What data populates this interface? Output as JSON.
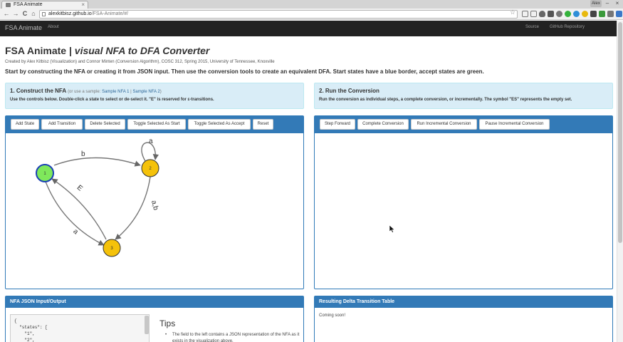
{
  "browser": {
    "tab_title": "FSA Animate",
    "tab_close": "×",
    "url_host": "alexkitbisz.github.io",
    "url_path": "/FSA-Animate/#/",
    "back": "←",
    "forward": "→",
    "reload": "C",
    "home": "⌂",
    "star": "☆",
    "user_badge": "Alex",
    "minimize": "–",
    "close": "×"
  },
  "navbar": {
    "brand": "FSA Animate",
    "about": "About",
    "source": "Source",
    "github": "GitHub Repository"
  },
  "header": {
    "title_plain": "FSA Animate | ",
    "title_italic": "visual NFA to DFA Converter",
    "credits": "Created by Alex Kitbisz (Visualization) and Connor Minten (Conversion Algorithm), COSC 312, Spring 2015, University of Tennessee, Knoxville",
    "instructions": "Start by constructing the NFA or creating it from JSON input. Then use the conversion tools to create an equivalent DFA. Start states have a blue border, accept states are green."
  },
  "construct": {
    "title": "1. Construct the NFA",
    "sample_prefix": "(or use a sample: ",
    "sample1": "Sample NFA 1",
    "sample_sep": " | ",
    "sample2": "Sample NFA 2",
    "sample_suffix": ")",
    "desc": "Use the controls below. Double-click a state to select or de-select it. \"E\" is reserved for ε-transitions.",
    "buttons": {
      "add_state": "Add State",
      "add_transition": "Add Transition",
      "delete_selected": "Delete Selected",
      "toggle_start": "Toggle Selected As Start",
      "toggle_accept": "Toggle Selected As Accept",
      "reset": "Reset"
    }
  },
  "conversion": {
    "title": "2. Run the Conversion",
    "desc": "Run the conversion as individual steps, a complete conversion, or incrementally. The symbol \"ES\" represents the empty set.",
    "buttons": {
      "step_forward": "Step Forward",
      "complete": "Complete Conversion",
      "run_incremental": "Run Incremental Conversion",
      "pause_incremental": "Pause Incremental Conversion"
    }
  },
  "nfa_graph": {
    "states": [
      {
        "label": "1",
        "start": true,
        "accept": true
      },
      {
        "label": "2",
        "start": false,
        "accept": false
      },
      {
        "label": "3",
        "start": false,
        "accept": false
      }
    ],
    "transitions": [
      {
        "from": "1",
        "to": "2",
        "label": "b"
      },
      {
        "from": "2",
        "to": "2",
        "label": "a"
      },
      {
        "from": "2",
        "to": "3",
        "label": "a,b"
      },
      {
        "from": "3",
        "to": "1",
        "label": "E"
      },
      {
        "from": "1",
        "to": "3",
        "label": "a"
      }
    ]
  },
  "json_panel": {
    "title": "NFA JSON Input/Output",
    "content": "{\n  \"states\": [\n    \"1\",\n    \"2\","
  },
  "tips": {
    "title": "Tips",
    "bullet": "•",
    "item1": "The field to the left contains a JSON representation of the NFA as it exists in the visualization above."
  },
  "delta_panel": {
    "title": "Resulting Delta Transition Table",
    "status": "Coming soon!"
  },
  "colors": {
    "navbar": "#222222",
    "panel_header": "#337ab7",
    "well": "#d9edf7",
    "start_border": "#1a3fb5",
    "accept_fill": "#7fe85b",
    "state_fill": "#f5c20a"
  }
}
